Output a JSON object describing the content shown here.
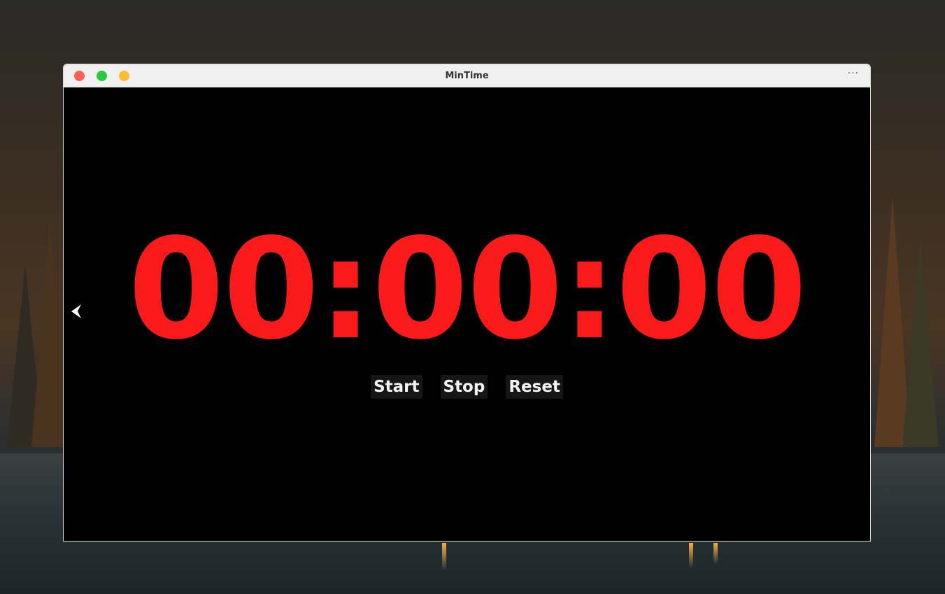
{
  "window": {
    "title": "MinTime",
    "more_menu": "···"
  },
  "timer": {
    "display": "00:00:00",
    "color": "#fa1a1a"
  },
  "controls": {
    "start_label": "Start",
    "stop_label": "Stop",
    "reset_label": "Reset"
  },
  "icons": {
    "back": "back-arrow-icon",
    "traffic_lights": [
      "close",
      "maximize",
      "minimize"
    ]
  }
}
